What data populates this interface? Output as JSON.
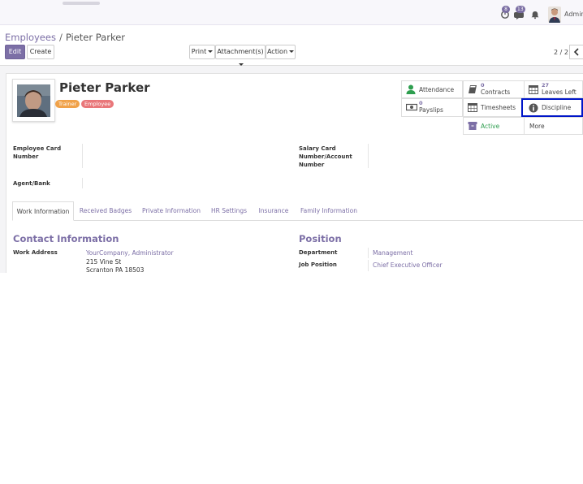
{
  "navbar": {
    "badge_activity": "8",
    "badge_messages": "13",
    "user_name": "Admini"
  },
  "breadcrumb": {
    "parent": "Employees",
    "separator": "/",
    "current": "Pieter Parker"
  },
  "toolbar": {
    "edit_label": "Edit",
    "create_label": "Create",
    "print_label": "Print",
    "attachments_label": "Attachment(s)",
    "action_label": "Action"
  },
  "pager": {
    "value": "2 / 2",
    "prev_icon": "chevron-left-icon"
  },
  "employee": {
    "name": "Pieter Parker",
    "tags": [
      {
        "label": "Trainer",
        "color": "#f0a24a"
      },
      {
        "label": "Employee",
        "color": "#e9777a"
      }
    ]
  },
  "smart_buttons": {
    "attendance": {
      "label": "Attendance",
      "icon": "user-icon",
      "color": "#2e9e4f"
    },
    "contracts": {
      "count": "0",
      "label": "Contracts",
      "icon": "book-icon"
    },
    "leaves": {
      "count": "27",
      "label": "Leaves Left",
      "icon": "calendar-icon"
    },
    "payslips": {
      "count": "0",
      "label": "Payslips",
      "icon": "money-icon"
    },
    "timesheets": {
      "label": "Timesheets",
      "icon": "calendar-icon"
    },
    "discipline": {
      "label": "Discipline",
      "icon": "info-icon"
    },
    "active": {
      "label": "Active",
      "icon": "archive-icon",
      "color": "#2e9e4f"
    },
    "more": {
      "label": "More"
    }
  },
  "fields": {
    "employee_card_line1": "Employee Card",
    "employee_card_line2": "Number",
    "salary_card_line1": "Salary Card",
    "salary_card_line2": "Number/Account",
    "salary_card_line3": "Number",
    "agent_bank": "Agent/Bank"
  },
  "tabs": [
    {
      "label": "Work Information"
    },
    {
      "label": "Received Badges"
    },
    {
      "label": "Private Information"
    },
    {
      "label": "HR Settings"
    },
    {
      "label": "Insurance"
    },
    {
      "label": "Family Information"
    }
  ],
  "contact": {
    "title": "Contact Information",
    "work_address_label": "Work Address",
    "company": "YourCompany, Administrator",
    "street": "215 Vine St",
    "city": "Scranton PA 18503"
  },
  "position": {
    "title": "Position",
    "department_label": "Department",
    "department_value": "Management",
    "job_label": "Job Position",
    "job_value": "Chief Executive Officer"
  },
  "colors": {
    "brand": "#7c6fa6",
    "active_green": "#2e9e4f",
    "selected_border": "#0016c8"
  }
}
